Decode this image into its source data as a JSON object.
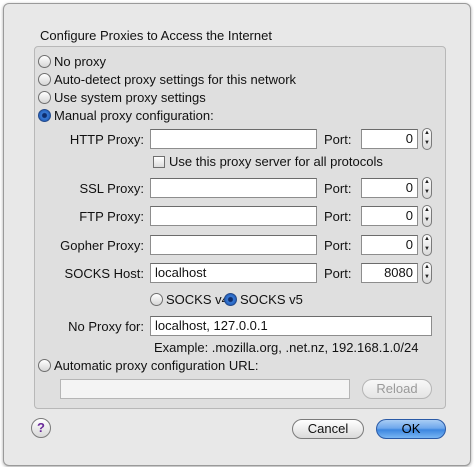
{
  "dialog": {
    "group_title": "Configure Proxies to Access the Internet",
    "options": {
      "no_proxy": "No proxy",
      "auto_detect": "Auto-detect proxy settings for this network",
      "use_system": "Use system proxy settings",
      "manual": "Manual proxy configuration:",
      "auto_url": "Automatic proxy configuration URL:"
    },
    "selected_option": "manual",
    "http": {
      "label": "HTTP Proxy:",
      "value": "",
      "port_label": "Port:",
      "port": "0"
    },
    "same_for_all": {
      "label": "Use this proxy server for all protocols",
      "checked": false
    },
    "ssl": {
      "label": "SSL Proxy:",
      "value": "",
      "port_label": "Port:",
      "port": "0"
    },
    "ftp": {
      "label": "FTP Proxy:",
      "value": "",
      "port_label": "Port:",
      "port": "0"
    },
    "gopher": {
      "label": "Gopher Proxy:",
      "value": "",
      "port_label": "Port:",
      "port": "0"
    },
    "socks": {
      "label": "SOCKS Host:",
      "value": "localhost",
      "port_label": "Port:",
      "port": "8080"
    },
    "socks_version": {
      "v4": "SOCKS v4",
      "v5": "SOCKS v5",
      "selected": "v5"
    },
    "no_proxy_for": {
      "label": "No Proxy for:",
      "value": "localhost, 127.0.0.1"
    },
    "example": "Example: .mozilla.org, .net.nz, 192.168.1.0/24",
    "auto_url_value": "",
    "reload_label": "Reload",
    "help_label": "?",
    "cancel_label": "Cancel",
    "ok_label": "OK"
  }
}
